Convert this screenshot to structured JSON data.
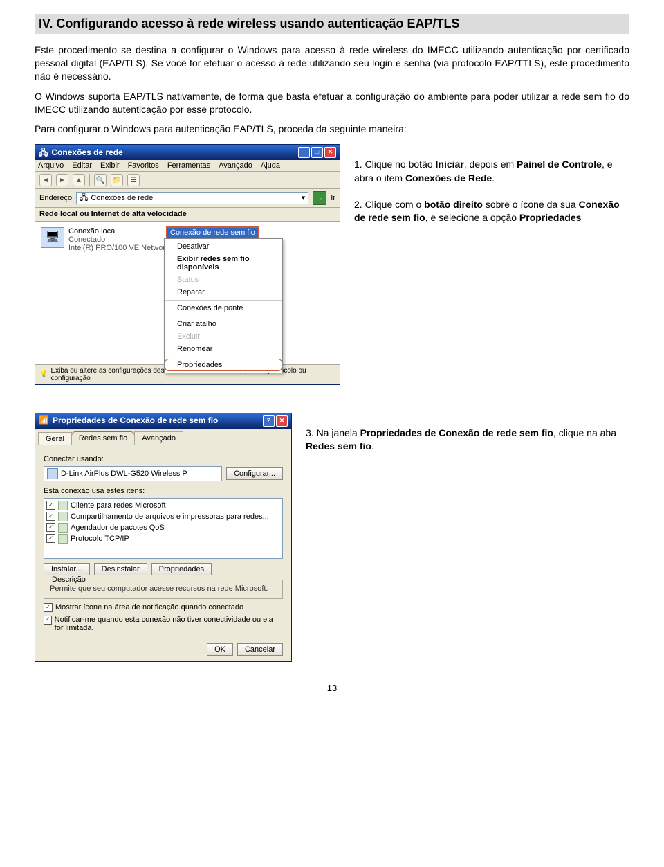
{
  "heading": "IV. Configurando acesso à rede wireless usando autenticação EAP/TLS",
  "para1": "Este procedimento se destina a configurar o Windows para acesso à rede wireless do IMECC utilizando autenticação por certificado pessoal digital (EAP/TLS). Se você for efetuar o acesso à rede utilizando seu login e senha (via protocolo EAP/TTLS), este procedimento não é necessário.",
  "para2": "O Windows suporta EAP/TLS nativamente, de forma que basta efetuar a configuração do ambiente para poder utilizar a rede sem fio do IMECC utilizando autenticação por esse protocolo.",
  "para3": "Para configurar o Windows para autenticação EAP/TLS, proceda da seguinte maneira:",
  "step1_pre": "1. Clique no botão ",
  "step1_b1": "Iniciar",
  "step1_mid1": ", depois em ",
  "step1_b2": "Painel de Controle",
  "step1_mid2": ", e abra o item ",
  "step1_b3": "Conexões de Rede",
  "step1_end": ".",
  "step2_pre": "2. Clique com o ",
  "step2_b1": "botão direito",
  "step2_mid1": " sobre o ícone da sua ",
  "step2_b2": "Conexão de rede sem fio",
  "step2_mid2": ", e selecione a opção ",
  "step2_b3": "Propriedades",
  "step3_pre": "3. Na janela ",
  "step3_b1": "Propriedades de Conexão de rede sem fio",
  "step3_mid": ", clique na aba ",
  "step3_b2": "Redes sem fio",
  "step3_end": ".",
  "conn": {
    "title": "Conexões de rede",
    "menu": [
      "Arquivo",
      "Editar",
      "Exibir",
      "Favoritos",
      "Ferramentas",
      "Avançado",
      "Ajuda"
    ],
    "addr_label": "Endereço",
    "addr_value": "Conexões de rede",
    "go": "Ir",
    "category": "Rede local ou Internet de alta velocidade",
    "local": {
      "name": "Conexão local",
      "status": "Conectado",
      "device": "Intel(R) PRO/100 VE Network..."
    },
    "wifi_label": "Conexão de rede sem fio",
    "ctx": {
      "disable": "Desativar",
      "show": "Exibir redes sem fio disponíveis",
      "status": "Status",
      "repair": "Reparar",
      "bridge": "Conexões de ponte",
      "shortcut": "Criar atalho",
      "delete": "Excluir",
      "rename": "Renomear",
      "props": "Propriedades"
    },
    "status": "Exiba ou altere as configurações desta conexão, tais como adaptador, protocolo ou configuração"
  },
  "props": {
    "title": "Propriedades de Conexão de rede sem fio",
    "tabs": {
      "geral": "Geral",
      "redes": "Redes sem fio",
      "avanc": "Avançado"
    },
    "connect_using": "Conectar usando:",
    "nic": "D-Link AirPlus DWL-G520 Wireless P",
    "configure": "Configurar...",
    "uses": "Esta conexão usa estes itens:",
    "items": [
      "Cliente para redes Microsoft",
      "Compartilhamento de arquivos e impressoras para redes...",
      "Agendador de pacotes QoS",
      "Protocolo TCP/IP"
    ],
    "install": "Instalar...",
    "uninstall": "Desinstalar",
    "properties": "Propriedades",
    "desc_title": "Descrição",
    "desc_text": "Permite que seu computador acesse recursos na rede Microsoft.",
    "chk1": "Mostrar ícone na área de notificação quando conectado",
    "chk2": "Notificar-me quando esta conexão não tiver conectividade ou ela for limitada.",
    "ok": "OK",
    "cancel": "Cancelar"
  },
  "page_number": "13"
}
